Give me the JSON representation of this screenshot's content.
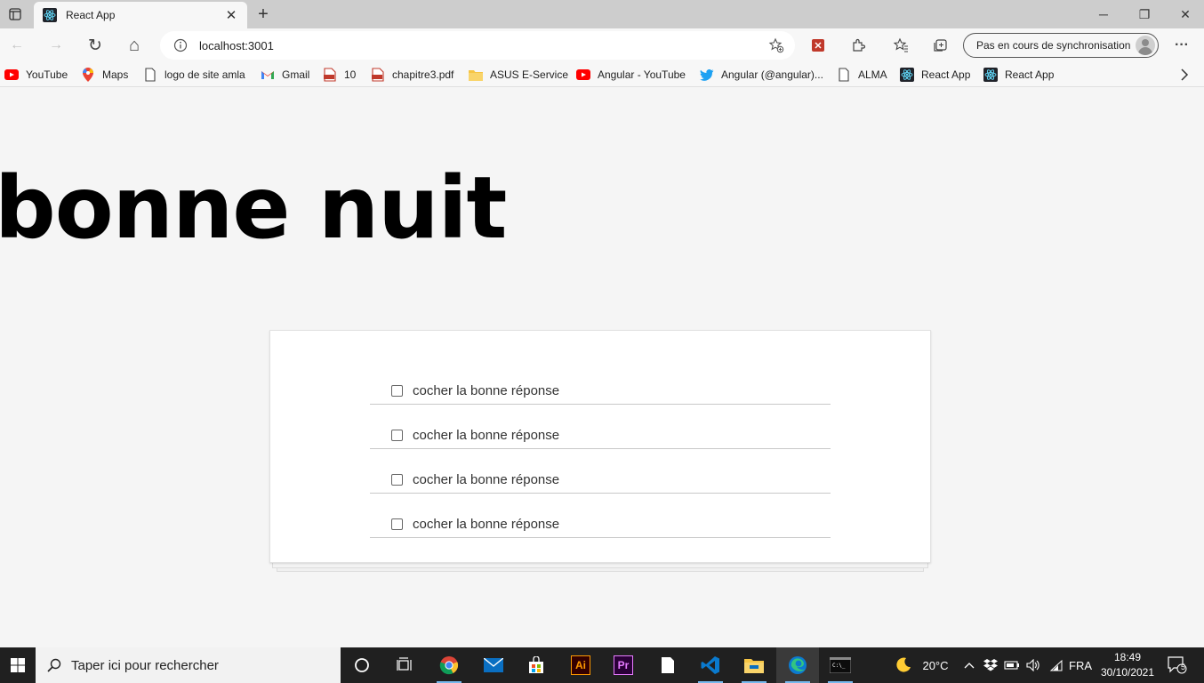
{
  "browser": {
    "tab": {
      "title": "React App",
      "close": "✕"
    },
    "new_tab": "+",
    "window_controls": {
      "minimize": "─",
      "restore": "❐",
      "close": "✕"
    },
    "nav": {
      "back": "←",
      "forward": "→",
      "refresh": "↻",
      "home": "⌂"
    },
    "address": {
      "url": "localhost:3001"
    },
    "sync_label": "Pas en cours de synchronisation",
    "menu": "···"
  },
  "bookmarks": [
    {
      "label": "YouTube",
      "icon": "youtube-icon"
    },
    {
      "label": "Maps",
      "icon": "maps-icon"
    },
    {
      "label": "logo de site amla",
      "icon": "page-icon"
    },
    {
      "label": "Gmail",
      "icon": "gmail-icon"
    },
    {
      "label": "10",
      "icon": "pdf-icon"
    },
    {
      "label": "chapitre3.pdf",
      "icon": "pdf-icon"
    },
    {
      "label": "ASUS E-Service",
      "icon": "folder-icon"
    },
    {
      "label": "Angular - YouTube",
      "icon": "youtube-icon"
    },
    {
      "label": "Angular (@angular)...",
      "icon": "twitter-icon"
    },
    {
      "label": "ALMA",
      "icon": "page-icon"
    },
    {
      "label": "React App",
      "icon": "react-icon"
    },
    {
      "label": "React App",
      "icon": "react-icon"
    }
  ],
  "page": {
    "heading": "bonne nuit",
    "options": [
      {
        "label": "cocher la bonne réponse",
        "checked": false
      },
      {
        "label": "cocher la bonne réponse",
        "checked": false
      },
      {
        "label": "cocher la bonne réponse",
        "checked": false
      },
      {
        "label": "cocher la bonne réponse",
        "checked": false
      }
    ]
  },
  "taskbar": {
    "search_placeholder": "Taper ici pour rechercher",
    "apps": [
      "task-view",
      "chrome",
      "mail",
      "store",
      "illustrator",
      "premiere",
      "notepad",
      "vscode",
      "file-explorer",
      "edge",
      "terminal"
    ],
    "weather": "20°C",
    "language": "FRA",
    "time": "18:49",
    "date": "30/10/2021",
    "notifications": "5",
    "ai_label": "Ai",
    "pr_label": "Pr"
  },
  "colors": {
    "accent": "#0a6fc2",
    "taskbar": "#202020",
    "page_bg": "#f5f5f5"
  }
}
